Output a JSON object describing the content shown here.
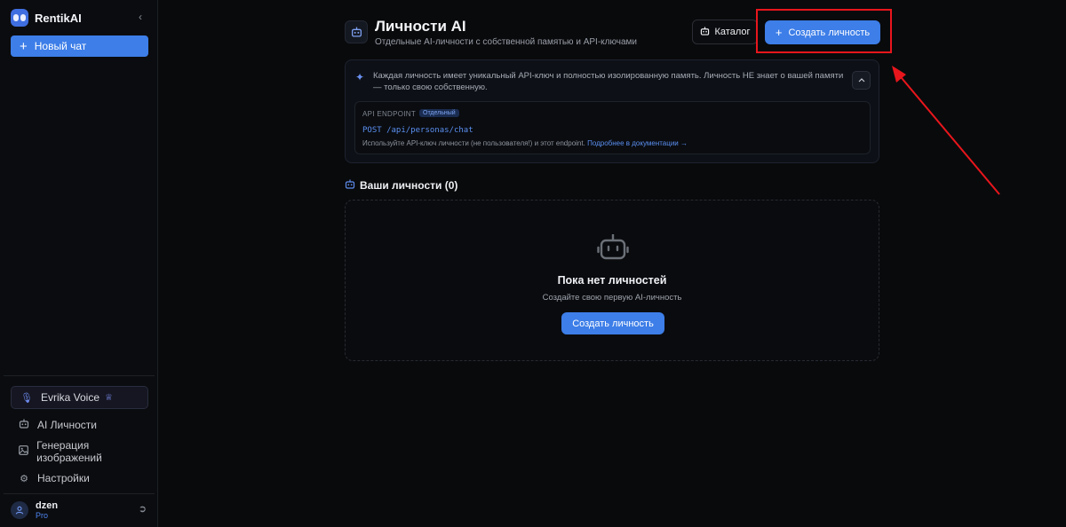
{
  "sidebar": {
    "brand": "RentikAI",
    "new_chat": "Новый чат",
    "voice": "Evrika Voice",
    "nav": [
      {
        "label": "AI Личности",
        "icon": "robot-icon"
      },
      {
        "label": "Генерация изображений",
        "icon": "image-icon"
      },
      {
        "label": "Настройки",
        "icon": "gear-icon"
      }
    ],
    "user": {
      "name": "dzen",
      "plan": "Pro"
    }
  },
  "header": {
    "title": "Личности AI",
    "subtitle": "Отдельные AI-личности с собственной памятью и API-ключами",
    "catalog": "Каталог",
    "create": "Создать личность"
  },
  "info": {
    "text": "Каждая личность имеет уникальный API-ключ и полностью изолированную память. Личность НЕ знает о вашей памяти — только свою собственную.",
    "endpoint_label": "API ENDPOINT",
    "endpoint_badge": "Отдельный",
    "endpoint_code": "POST /api/personas/chat",
    "note": "Используйте API-ключ личности (не пользователя!) и этот endpoint.",
    "doc_link": "Подробнее в документации →"
  },
  "personas": {
    "section_title": "Ваши личности (0)",
    "empty_title": "Пока нет личностей",
    "empty_subtitle": "Создайте свою первую AI-личность",
    "empty_button": "Создать личность"
  },
  "colors": {
    "accent": "#3d7ee8",
    "annotation": "#e8161c",
    "background": "#090a0c"
  }
}
